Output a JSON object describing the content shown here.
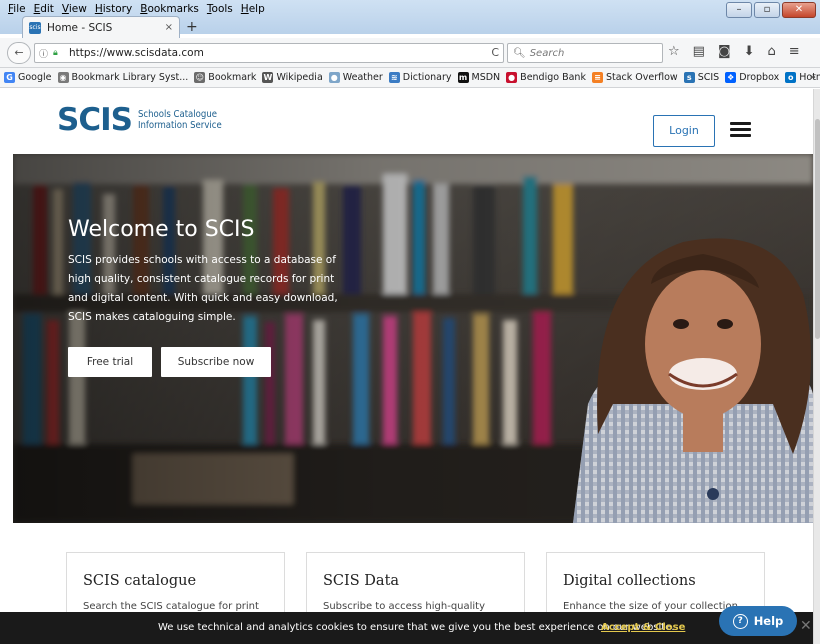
{
  "menubar": [
    "File",
    "Edit",
    "View",
    "History",
    "Bookmarks",
    "Tools",
    "Help"
  ],
  "window_buttons": {
    "minimize": "–",
    "maximize": "▫",
    "close": "✕"
  },
  "tab": {
    "favicon": "scis",
    "title": "Home - SCIS",
    "close": "×",
    "new_tab": "+"
  },
  "nav": {
    "back": "←",
    "url": "https://www.scisdata.com",
    "reload": "C",
    "search_placeholder": "Search",
    "icons": [
      "star-icon",
      "bookmarks-library-icon",
      "pocket-icon",
      "download-icon",
      "home-icon",
      "menu-icon"
    ]
  },
  "bookmarks": [
    {
      "label": "Google",
      "icon": "G",
      "color": "#4285f4"
    },
    {
      "label": "Bookmark Library Syst...",
      "icon": "◉",
      "color": "#7a7a7a"
    },
    {
      "label": "Bookmark",
      "icon": "☺",
      "color": "#6b6b6b"
    },
    {
      "label": "Wikipedia",
      "icon": "W",
      "color": "#555555"
    },
    {
      "label": "Weather",
      "icon": "●",
      "color": "#7fa6c9"
    },
    {
      "label": "Dictionary",
      "icon": "≋",
      "color": "#3b7cc4"
    },
    {
      "label": "MSDN",
      "icon": "m",
      "color": "#111111"
    },
    {
      "label": "Bendigo Bank",
      "icon": "●",
      "color": "#c8102e"
    },
    {
      "label": "Stack Overflow",
      "icon": "≡",
      "color": "#f48024"
    },
    {
      "label": "SCIS",
      "icon": "s",
      "color": "#2a73b4"
    },
    {
      "label": "Dropbox",
      "icon": "❖",
      "color": "#0061ff"
    },
    {
      "label": "Hotmail",
      "icon": "o",
      "color": "#0072c6"
    }
  ],
  "bookmarks_overflow": "»",
  "site": {
    "logo_mark": "SCIS",
    "logo_line1": "Schools Catalogue",
    "logo_line2": "Information Service",
    "login": "Login"
  },
  "hero": {
    "title": "Welcome to SCIS",
    "text": "SCIS provides schools with access to a database of high quality, consistent catalogue records for print and digital content. With quick and easy download, SCIS makes cataloguing simple.",
    "btn_trial": "Free trial",
    "btn_subscribe": "Subscribe now"
  },
  "cards": [
    {
      "title": "SCIS catalogue",
      "text": "Search the SCIS catalogue for print"
    },
    {
      "title": "SCIS Data",
      "text": "Subscribe to access high-quality"
    },
    {
      "title": "Digital collections",
      "text": "Enhance the size of your collection with"
    }
  ],
  "cookie": {
    "message": "We use technical and analytics cookies to ensure that we give you the best experience on our website.",
    "accept": "Accept & Close",
    "close": "✕"
  },
  "help": {
    "label": "Help",
    "icon": "?"
  }
}
